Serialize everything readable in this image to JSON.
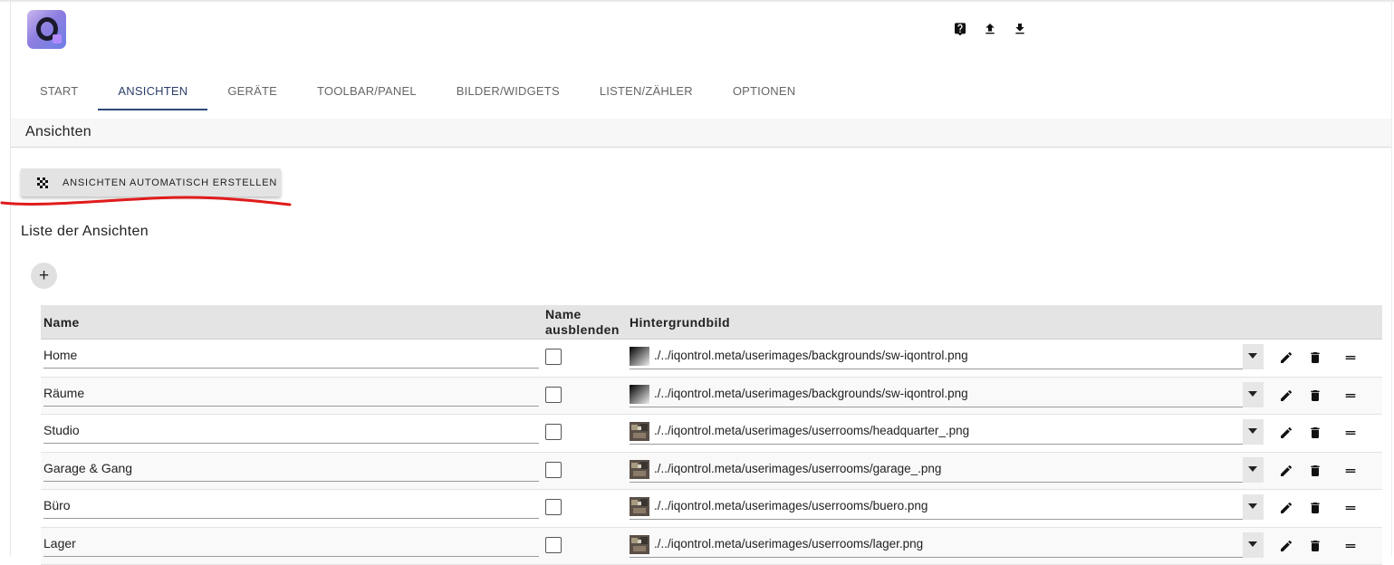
{
  "header": {
    "logo_icon": "iqontrol-q-logo",
    "top_icons": [
      "help-icon",
      "upload-icon",
      "download-icon"
    ]
  },
  "tabs": [
    {
      "label": "START",
      "active": false
    },
    {
      "label": "ANSICHTEN",
      "active": true
    },
    {
      "label": "GERÄTE",
      "active": false
    },
    {
      "label": "TOOLBAR/PANEL",
      "active": false
    },
    {
      "label": "BILDER/WIDGETS",
      "active": false
    },
    {
      "label": "LISTEN/ZÄHLER",
      "active": false
    },
    {
      "label": "OPTIONEN",
      "active": false
    }
  ],
  "section": {
    "title": "Ansichten"
  },
  "auto_button": {
    "label": "ANSICHTEN AUTOMATISCH ERSTELLEN",
    "icon": "auto-fix-icon"
  },
  "list": {
    "title": "Liste der Ansichten",
    "add_label": "+",
    "columns": {
      "name": "Name",
      "hide_line1": "Name",
      "hide_line2": "ausblenden",
      "background": "Hintergrundbild"
    },
    "rows": [
      {
        "name": "Home",
        "hide": false,
        "background": "./../iqontrol.meta/userimages/backgrounds/sw-iqontrol.png",
        "thumb": "gradient"
      },
      {
        "name": "Räume",
        "hide": false,
        "background": "./../iqontrol.meta/userimages/backgrounds/sw-iqontrol.png",
        "thumb": "gradient"
      },
      {
        "name": "Studio",
        "hide": false,
        "background": "./../iqontrol.meta/userimages/userrooms/headquarter_.png",
        "thumb": "room"
      },
      {
        "name": "Garage & Gang",
        "hide": false,
        "background": "./../iqontrol.meta/userimages/userrooms/garage_.png",
        "thumb": "room"
      },
      {
        "name": "Büro",
        "hide": false,
        "background": "./../iqontrol.meta/userimages/userrooms/buero.png",
        "thumb": "room"
      },
      {
        "name": "Lager",
        "hide": false,
        "background": "./../iqontrol.meta/userimages/userrooms/lager.png",
        "thumb": "room"
      }
    ]
  },
  "colors": {
    "accent": "#2c4a7a",
    "annotation": "#e01b1b"
  }
}
